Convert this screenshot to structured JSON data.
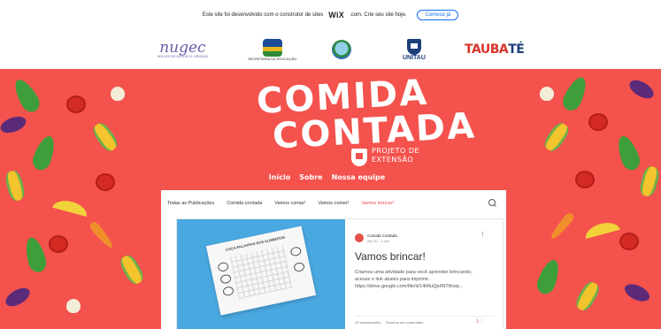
{
  "wix_banner": {
    "text": "Este site foi desenvolvido com o construtor de sites",
    "brand": "WiX",
    "text2": ".com. Crie seu site hoje.",
    "cta": "Comece já"
  },
  "partners": {
    "nugec": "nugec",
    "nugec_sub": "NÚCLEO DE GESTÃO E CIÊNCIAS",
    "secretaria": "SECRETARIA DA EDUCAÇÃO",
    "unitau": "UNITAU",
    "taubate_a": "TAUBA",
    "taubate_b": "TÉ"
  },
  "hero": {
    "title_line1": "COMIDA",
    "title_line2": "CONTADA",
    "project_line1": "PROJETO DE",
    "project_line2": "EXTENSÃO",
    "nav": [
      "Início",
      "Sobre",
      "Nossa equipe"
    ]
  },
  "blog": {
    "tabs": [
      "Todas as Publicações",
      "Comida contada",
      "Vamos contar!",
      "Vamos comer!",
      "Vamos brincar!"
    ],
    "active_tab": "Vamos brincar!",
    "post": {
      "author": "Comida Contada",
      "date": "Abr 20 · 1 min",
      "title": "Vamos brincar!",
      "excerpt": "Criamos uma atividade para você aprender brincando, acesse o link abaixo para imprimir. https://drive.google.com/file/d/14iMuQp4NTtKwp...",
      "views": "10 visualizações",
      "comment": "Escreva um comentário",
      "likes": "1 ♡",
      "thumb_title": "CAÇA-PALAVRAS DOS ALIMENTOS"
    }
  },
  "colors": {
    "hero_bg": "#f4524d",
    "accent": "#e2514a"
  }
}
